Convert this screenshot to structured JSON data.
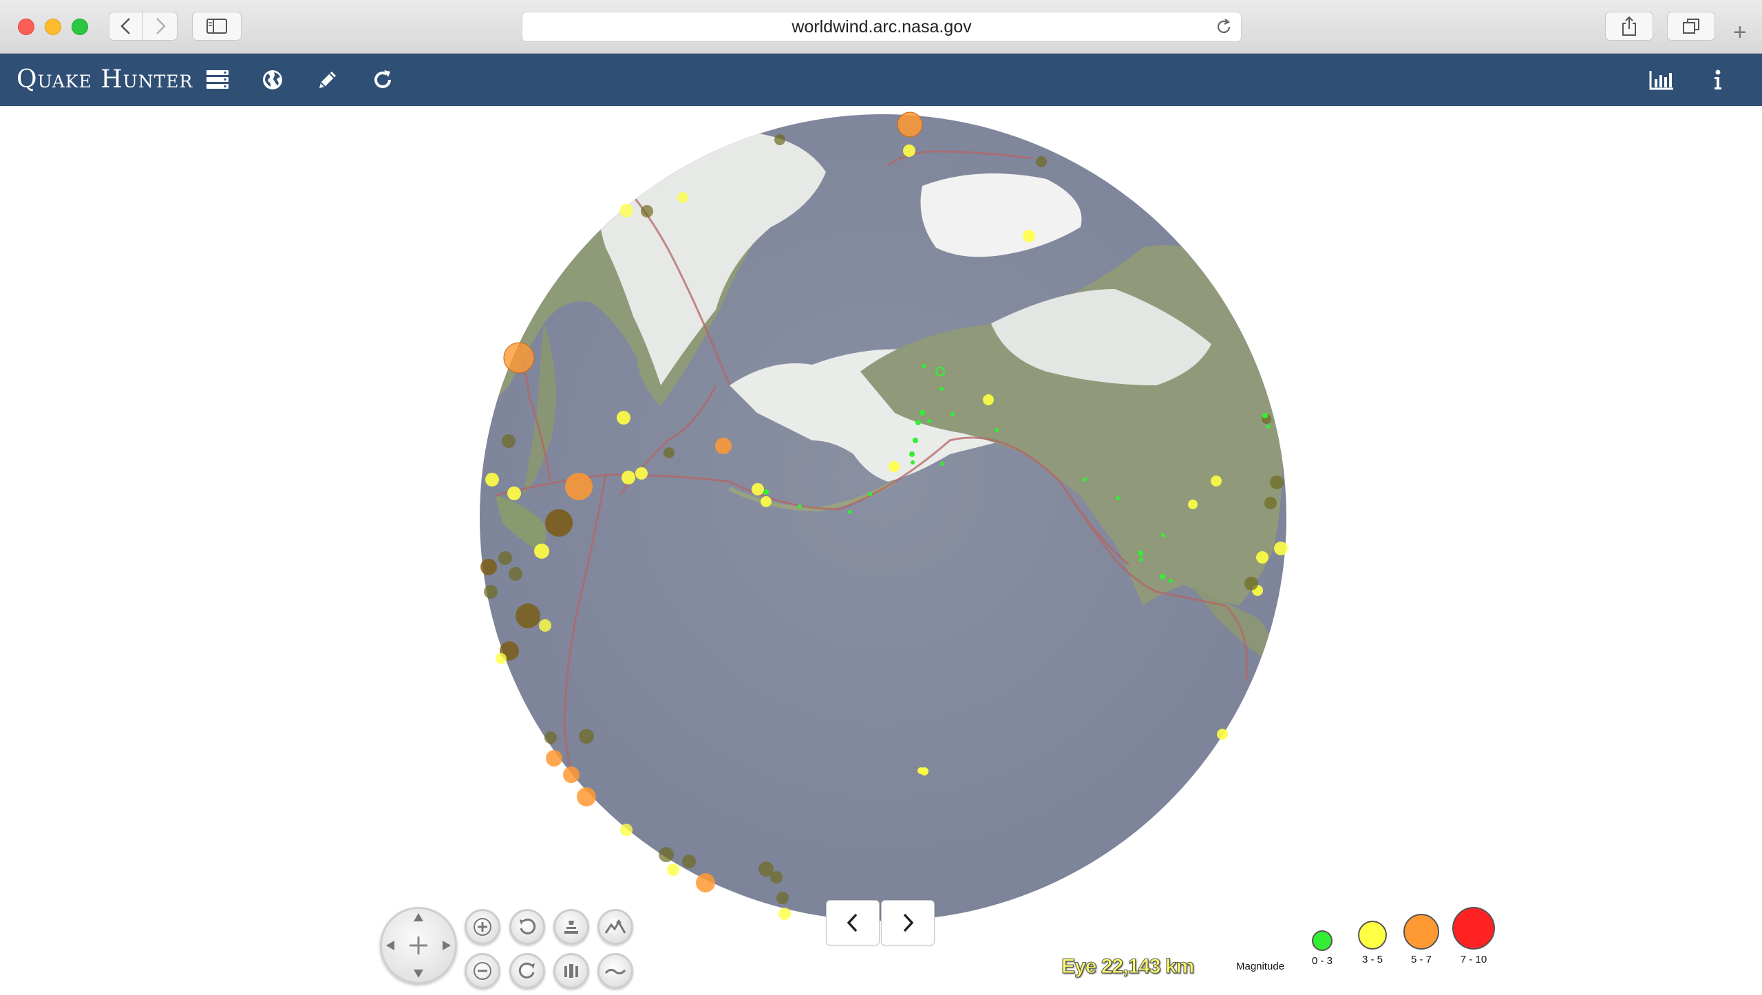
{
  "browser": {
    "url": "worldwind.arc.nasa.gov"
  },
  "app": {
    "title": "Quake Hunter",
    "toolbar_icons": [
      "layers-icon",
      "globe-icon",
      "pencil-icon",
      "refresh-icon"
    ],
    "right_icons": [
      "bar-chart-icon",
      "info-icon"
    ]
  },
  "globe": {
    "eye_label": "Eye",
    "eye_altitude": "22,143 km",
    "ocean_color": "#868da1",
    "land_color": "#8e9a78",
    "ice_color": "#eef0ee",
    "plate_boundary_color": "#b36666"
  },
  "legend": {
    "title": "Magnitude",
    "items": [
      {
        "label": "0 - 3",
        "color": "#33ee33"
      },
      {
        "label": "3 - 5",
        "color": "#ffff44"
      },
      {
        "label": "5 - 7",
        "color": "#ff9933"
      },
      {
        "label": "7 - 10",
        "color": "#ff2222"
      }
    ]
  },
  "controls": {
    "buttons": [
      "zoom-in",
      "zoom-out",
      "rotate-ccw",
      "rotate-cw",
      "tilt-up",
      "tilt-down",
      "exaggeration-up",
      "exaggeration-down"
    ],
    "prev_icon": "chevron-left-icon",
    "next_icon": "chevron-right-icon"
  }
}
